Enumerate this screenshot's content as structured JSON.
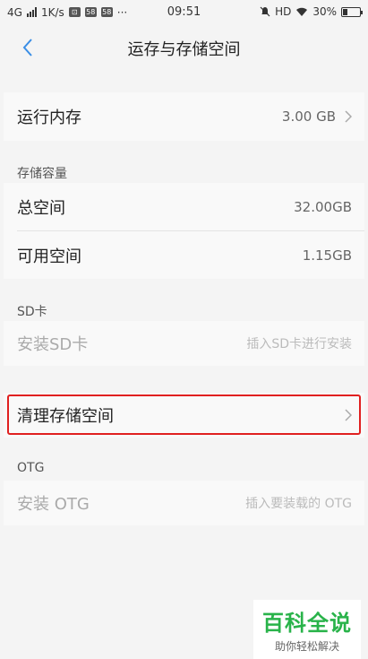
{
  "status_bar": {
    "network": "4G",
    "speed": "1K/s",
    "app_badges": [
      "⊡",
      "58",
      "58"
    ],
    "more": "···",
    "time": "09:51",
    "hd": "HD",
    "battery": "30%",
    "battery_level": 0.3
  },
  "nav": {
    "title": "运存与存储空间"
  },
  "ram": {
    "label": "运行内存",
    "value": "3.00 GB"
  },
  "storage": {
    "header": "存储容量",
    "total_label": "总空间",
    "total_value": "32.00GB",
    "available_label": "可用空间",
    "available_value": "1.15GB"
  },
  "sd": {
    "header": "SD卡",
    "install_label": "安装SD卡",
    "install_hint": "插入SD卡进行安装"
  },
  "clean": {
    "label": "清理存储空间"
  },
  "otg": {
    "header": "OTG",
    "install_label": "安装 OTG",
    "install_hint": "插入要装载的 OTG"
  },
  "watermark": {
    "title": "百科全说",
    "subtitle": "助你轻松解决"
  }
}
